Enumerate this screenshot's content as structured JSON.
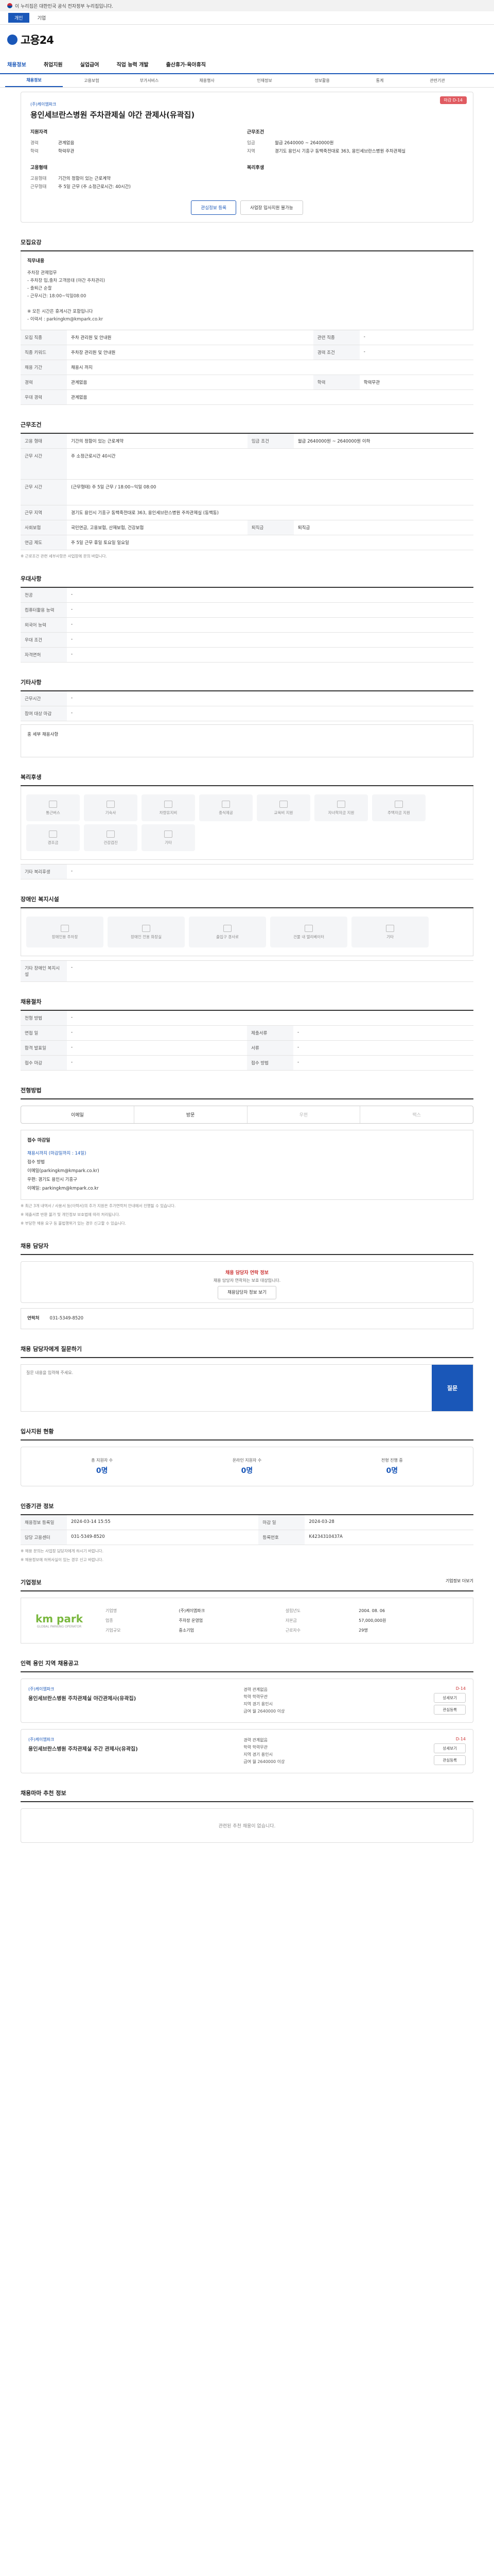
{
  "gov_banner": "이 누리집은 대한민국 공식 전자정부 누리집입니다.",
  "top_tabs": [
    "개인",
    "기업"
  ],
  "logo": "고용24",
  "gnb": [
    "채용정보",
    "취업지원",
    "실업급여",
    "직업 능력 개발",
    "출산휴가·육아휴직"
  ],
  "subtabs": [
    "채용정보",
    "고용보험",
    "부가서비스",
    "채용행사",
    "인재정보",
    "정보활용",
    "통계",
    "관련기관"
  ],
  "card": {
    "company": "(주)케이엠파크",
    "title": "용인세브란스병원 주차관제실 야간 관제사(유곽집)",
    "dday": "마감 D-14",
    "qual_title": "지원자격",
    "qual": [
      [
        "경력",
        "관계없음"
      ],
      [
        "학력",
        "학력무관"
      ]
    ],
    "cond_title": "근무조건",
    "cond": [
      [
        "임금",
        "월급 2640000 ~ 2640000원"
      ],
      [
        "지역",
        "경기도 용인시 기흥구 동백죽전대로 363, 용인세브란스병원 주차관제실"
      ]
    ],
    "form_title": "고용형태",
    "form": [
      [
        "고용형태",
        "기간의 정함이 있는 근로계약"
      ],
      [
        "근무형태",
        "주 5일 근무 (주 소정근로시간: 40시간)"
      ]
    ],
    "welfare_title": "복리후생",
    "btn1": "관심정보 등록",
    "btn2": "사업장 입사지원 불가능"
  },
  "recruit_sec": {
    "title": "모집요강",
    "job_title": "직무내용",
    "job_desc": "주차장 관제업무\n- 주차장 입,출차 고객응대 (야간 주차관리)\n- 출퇴근 순찰\n- 근무시간: 18:00~익일08:00\n\n※ 모든 시간은 휴게시간 포함입니다\n- 이력서 : parkingkm@kmpark.co.kr",
    "rows": [
      [
        "모집 직종",
        "주차 관리원 및 안내원",
        "관련 직종",
        "-"
      ],
      [
        "직종 키워드",
        "주차장 관리원 및 안내원",
        "경력 조건",
        "-"
      ],
      [
        "채용 기간",
        "채용시 까지",
        "",
        ""
      ],
      [
        "경력",
        "관계없음",
        "학력",
        "학력무관"
      ],
      [
        "우대 경력",
        "관계없음",
        "",
        ""
      ]
    ]
  },
  "work_sec": {
    "title": "근무조건",
    "rows": [
      [
        "고용 형태",
        "기간의 정함이 있는 근로계약",
        "임금 조건",
        "월급 2640000원 ~ 2640000원 이하"
      ],
      [
        "근무 시간",
        "주 소정근로시간 40시간",
        "",
        ""
      ],
      [
        "근무 시간",
        "(근무형태) 주 5일 근무 / 18:00~익일 08:00",
        "",
        ""
      ],
      [
        "근무 지역",
        "경기도 용인시 기흥구 동백죽전대로 363, 용인세브란스병원 주차관제실 (동백동)",
        "",
        ""
      ],
      [
        "사회보험",
        "국민연금, 고용보험, 산재보험, 건강보험",
        "퇴직금",
        "퇴직금"
      ],
      [
        "연금 제도",
        "주 5일 근무 휴일 토요일 일요일",
        "",
        ""
      ]
    ],
    "note": "※ 근로조건 관련 세부사항은 사업장에 문의 바랍니다."
  },
  "pref_sec": {
    "title": "우대사항",
    "rows": [
      [
        "전공",
        "-"
      ],
      [
        "컴퓨터활용 능력",
        "-"
      ],
      [
        "외국어 능력",
        "-"
      ],
      [
        "우대 조건",
        "-"
      ],
      [
        "자격면허",
        "-"
      ]
    ]
  },
  "other_sec": {
    "title": "기타사항",
    "rows": [
      [
        "근무시간",
        "-"
      ],
      [
        "참여 대상 마감",
        "-"
      ]
    ],
    "text": "홍 세부 채용사항"
  },
  "welfare_sec": {
    "title": "복리후생",
    "items": [
      "통근버스",
      "기숙사",
      "차량유지비",
      "중식제공",
      "교육비 지원",
      "자녀학자금 지원",
      "주택자금 지원",
      "경조금",
      "건강검진",
      "기타"
    ],
    "extra_label": "기타 복리후생",
    "extra": "-"
  },
  "disabled_sec": {
    "title": "장애인 복지시설",
    "items": [
      "장애인용 주차장",
      "장애인 전용 화장실",
      "출입구 경사로",
      "건물 내 엘리베이터",
      "기타"
    ],
    "extra_label": "기타 장애인 복지시설",
    "extra": "-"
  },
  "selection_sec": {
    "title": "채용절차",
    "rows": [
      [
        "전형 방법",
        "-",
        "",
        ""
      ],
      [
        "면접 일",
        "-",
        "제출서류",
        "-"
      ],
      [
        "합격 발표일",
        "-",
        "서류",
        "-"
      ],
      [
        "접수 마감",
        "-",
        "접수 방법",
        "-"
      ]
    ]
  },
  "apply_sec": {
    "title": "전형방법",
    "methods": [
      "이메일",
      "방문",
      "우편",
      "팩스"
    ],
    "contact_title": "접수 마감일",
    "contact_lines": [
      "채용시까지 (마감일까지 : 14일)",
      "접수 방법",
      "이메일(parkingkm@kmpark.co.kr)",
      "우편: 경기도 용인시 기흥구",
      "이메일: parkingkm@kmpark.co.kr"
    ],
    "notes": [
      "※ 최근 3개 내역서 / 사용서 등(이력서)의 추가 지원은 추가연락처 안내에서 진행될 수 있습니다.",
      "※ 제출서류 반환 불가 및 개인정보 보호법에 따라 처리됩니다.",
      "※ 부당한 채용 요구 등 불법행위가 있는 경우 신고할 수 있습니다."
    ]
  },
  "manager_sec": {
    "title": "채용 담당자",
    "notice": "채용 담당자 연락 정보",
    "notice2": "채용 담당자 연락처는 보호 대상입니다.",
    "btn": "채용담당자 정보 보기",
    "tel_label": "연락처",
    "tel": "031-5349-8520"
  },
  "qna_sec": {
    "title": "채용 담당자에게 질문하기",
    "placeholder": "질문 내용을 입력해 주세요.",
    "btn": "질문"
  },
  "stats_sec": {
    "title": "입사지원 현황",
    "items": [
      [
        "총 지원자 수",
        "0명"
      ],
      [
        "온라인 지원자 수",
        "0명"
      ],
      [
        "전형 진행 중",
        "0명"
      ]
    ]
  },
  "reg_sec": {
    "title": "인증기관 정보",
    "rows": [
      [
        "채용정보 등록일",
        "2024-03-14 15:55",
        "마감 일",
        "2024-03-28"
      ],
      [
        "담당 고용센터",
        "031-5349-8520",
        "등록번호",
        "K4234310437A"
      ]
    ],
    "notes": [
      "※ 채용 문의는 사업장 담당자에게 하시기 바랍니다.",
      "※ 채용정보에 허위사실이 있는 경우 신고 바랍니다."
    ]
  },
  "company_sec": {
    "title": "기업정보",
    "logo_text": "km park",
    "logo_sub": "GLOBAL PARKING OPERATOR",
    "rows": [
      [
        "기업명",
        "(주)케이엠파크",
        "설립년도",
        "2004. 08. 06"
      ],
      [
        "업종",
        "주차장 운영업",
        "자본금",
        "57,000,000원"
      ],
      [
        "기업규모",
        "중소기업",
        "근로자수",
        "29명"
      ]
    ],
    "more": "기업정보 더보기"
  },
  "related_sec": {
    "title": "인력 용인 지역 채용공고",
    "items": [
      {
        "company": "(주)케이엠파크",
        "title": "용인세브란스병원 주차관제실 야간관제사(유곽집)",
        "info": [
          "경력 관계없음",
          "학력 학력무관",
          "지역 경기 용인시",
          "급여 월 2640000 이상"
        ],
        "dday": "D-14"
      },
      {
        "company": "(주)케이엠파크",
        "title": "용인세브란스병원 주차관제실 주간 관제사(유곽집)",
        "info": [
          "경력 관계없음",
          "학력 학력무관",
          "지역 경기 용인시",
          "급여 월 2640000 이상"
        ],
        "dday": "D-14"
      }
    ],
    "btn_detail": "상세보기",
    "btn_apply": "관심등록"
  },
  "recommend_sec": {
    "title": "채용마마 추천 정보",
    "empty": "관련된 추천 채용이 없습니다."
  }
}
